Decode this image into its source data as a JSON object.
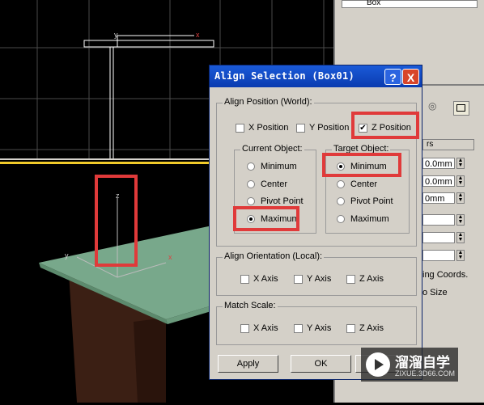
{
  "cmd_panel": {
    "list_item": "Box",
    "section_header": "rs",
    "spinner_values": [
      "0.0mm",
      "0.0mm",
      "0mm"
    ],
    "text_coords": "ing Coords.",
    "text_size": "o Size"
  },
  "viewport_top": {
    "axis_y": "y",
    "axis_x": "x"
  },
  "viewport_persp": {
    "axis_z": "z",
    "axis_y": "y",
    "axis_x": "x"
  },
  "dialog": {
    "title": "Align Selection (Box01)",
    "help_icon": "?",
    "close_icon": "X",
    "align_position": {
      "label": "Align Position (World):",
      "x_label": "X Position",
      "x_checked": false,
      "y_label": "Y Position",
      "y_checked": false,
      "z_label": "Z Position",
      "z_checked": true
    },
    "current_object": {
      "label": "Current Object:",
      "options": [
        "Minimum",
        "Center",
        "Pivot Point",
        "Maximum"
      ],
      "selected": "Maximum"
    },
    "target_object": {
      "label": "Target Object:",
      "options": [
        "Minimum",
        "Center",
        "Pivot Point",
        "Maximum"
      ],
      "selected": "Minimum"
    },
    "align_orientation": {
      "label": "Align Orientation (Local):",
      "x": "X Axis",
      "y": "Y Axis",
      "z": "Z Axis"
    },
    "match_scale": {
      "label": "Match Scale:",
      "x": "X Axis",
      "y": "Y Axis",
      "z": "Z Axis"
    },
    "buttons": {
      "apply": "Apply",
      "ok": "OK"
    }
  },
  "watermark": {
    "title": "溜溜自学",
    "url": "ZIXUE.3D66.COM"
  },
  "colors": {
    "highlight": "#e03a3a",
    "titlebar": "#0a3bb0",
    "tabletop": "#78a88b"
  }
}
